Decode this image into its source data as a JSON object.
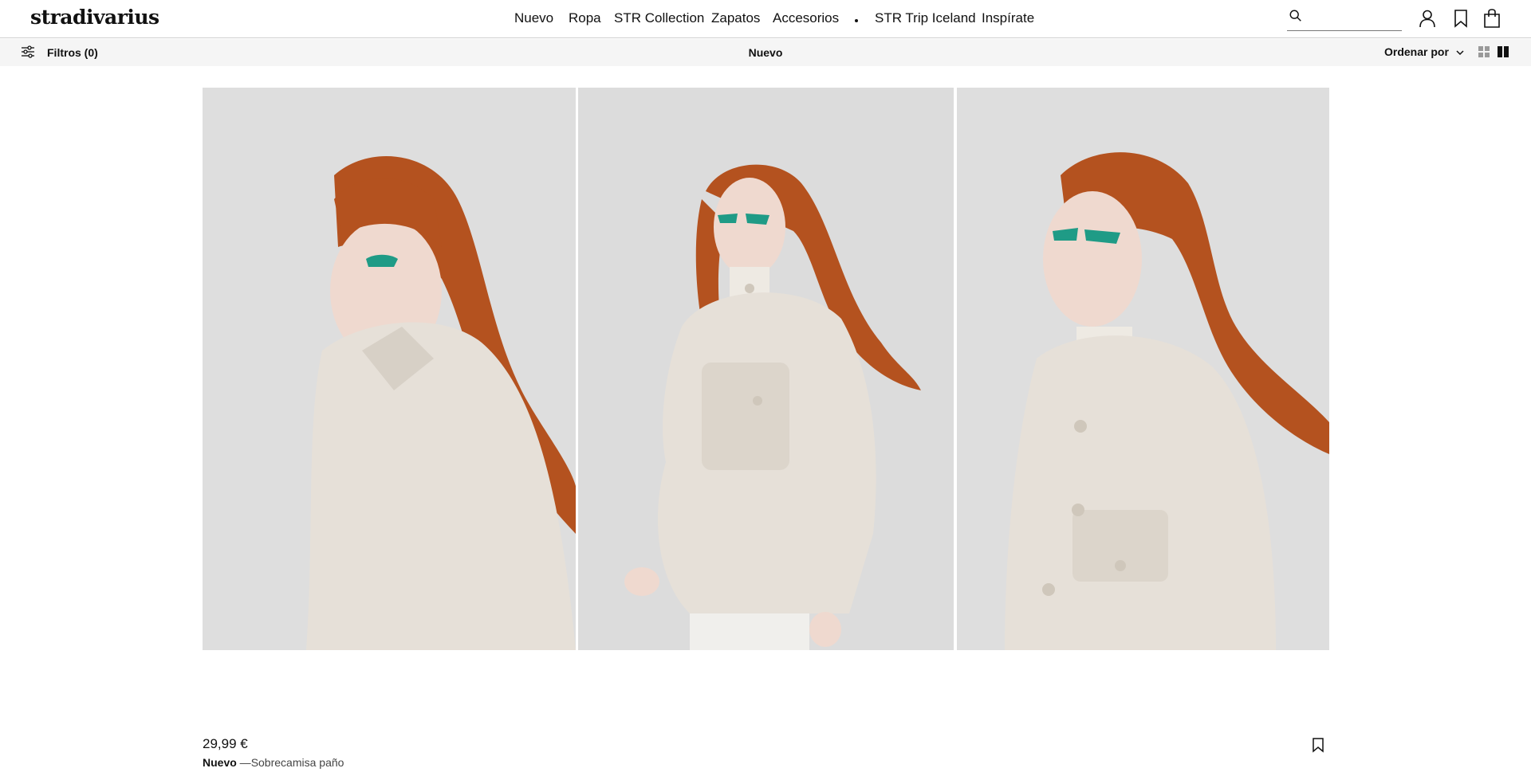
{
  "header": {
    "logo": "stradivarius",
    "nav": [
      {
        "label": "Nuevo"
      },
      {
        "label": "Ropa"
      },
      {
        "label": "STR Collection"
      },
      {
        "label": "Zapatos"
      },
      {
        "label": "Accesorios"
      },
      {
        "label": "STR Trip Iceland"
      },
      {
        "label": "Inspírate"
      }
    ],
    "search": {
      "placeholder": "",
      "value": ""
    },
    "icons": [
      "search-icon",
      "user-icon",
      "bookmark-icon",
      "bag-icon"
    ]
  },
  "filterbar": {
    "filters_label": "Filtros (0)",
    "category": "Nuevo",
    "sort_label": "Ordenar por",
    "icons": [
      "filters-icon",
      "chevron-down-icon",
      "grid-four-icon",
      "grid-two-icon"
    ]
  },
  "product": {
    "price": "29,99 €",
    "badge": "Nuevo",
    "separator": " —",
    "name": "Sobrecamisa paño",
    "icons": [
      "bookmark-icon"
    ]
  },
  "colors": {
    "text": "#111111",
    "filterbar_bg": "#f5f5f5",
    "photo_bg": "#dcdcdc",
    "coat": "#e6e0d8",
    "hair": "#b4521f"
  }
}
